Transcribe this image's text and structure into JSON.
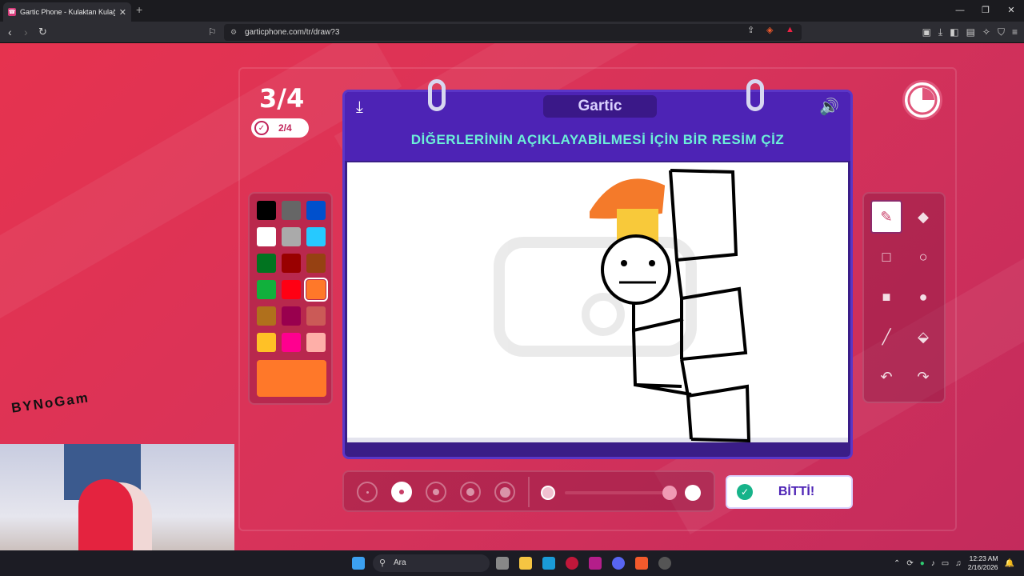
{
  "browser": {
    "tab_title": "Gartic Phone - Kulaktan Kulağa",
    "tab_close": "✕",
    "new_tab": "+",
    "url": "garticphone.com/tr/draw?3",
    "window_controls": [
      "—",
      "❐",
      "✕"
    ]
  },
  "game": {
    "round": "3/4",
    "done_count": "2/4",
    "logo": "Gartic",
    "instruction": "DİĞERLERİNİN AÇIKLAYABİLMESİ İÇİN BİR RESİM ÇİZ",
    "done_button": "BİTTİ!",
    "palette": [
      "#000000",
      "#666666",
      "#0050cd",
      "#ffffff",
      "#aaaaaa",
      "#26c9ff",
      "#017420",
      "#990000",
      "#964112",
      "#11b03c",
      "#ff0013",
      "#ff7829",
      "#b0701c",
      "#99004e",
      "#cb5a57",
      "#ffc126",
      "#ff008f",
      "#feafa8"
    ],
    "selected_color": "#ff7829",
    "selected_tool": "pencil-tool",
    "selected_size_index": 1,
    "tools": [
      "pencil",
      "eraser",
      "rectangle-outline",
      "ellipse-outline",
      "rectangle-fill",
      "ellipse-fill",
      "line",
      "bucket",
      "undo",
      "redo"
    ]
  },
  "overlay": {
    "signature": "BYNoGam"
  },
  "taskbar": {
    "search_placeholder": "Ara",
    "time": "12:23 AM",
    "date": "2/16/2026"
  }
}
